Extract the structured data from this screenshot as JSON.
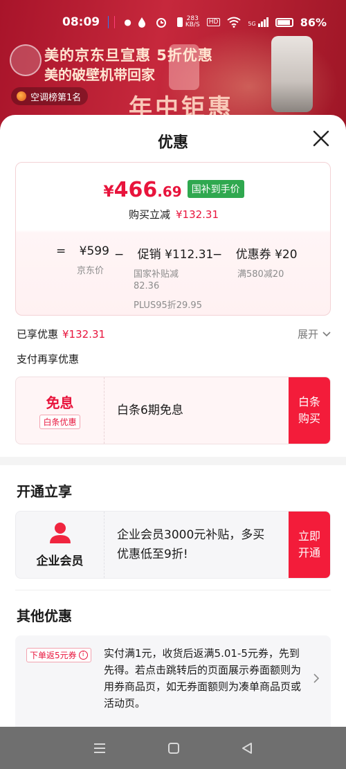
{
  "status_bar": {
    "time": "08:09",
    "net_speed_top": "283",
    "net_speed_unit": "KB/S",
    "hd": "HD",
    "signal_label": "5G",
    "battery": "86%"
  },
  "background": {
    "promo_line1": "美的京东旦宣惠 5折优惠",
    "promo_line2": "美的破壁机带回家",
    "rank_pill": "空调榜第1名",
    "banner_text": "年中钜惠"
  },
  "sheet": {
    "title": "优惠",
    "price_card": {
      "yen": "¥",
      "price_int": "466",
      "price_dec": ".69",
      "tag": "国补到手价",
      "reduce_label": "购买立减",
      "reduce_amount": "¥132.31",
      "formula": {
        "eq": "=",
        "base_value": "¥599",
        "base_label": "京东价",
        "minus1": "−",
        "promo_label": "促销",
        "promo_value": "¥112.31",
        "promo_sub1": "国家补贴减",
        "promo_sub1_value": "82.36",
        "promo_sub2": "PLUS95折29.95",
        "minus2": "−",
        "coupon_label": "优惠券",
        "coupon_value": "¥20",
        "coupon_sub": "满580减20"
      }
    },
    "enjoyed_label": "已享优惠",
    "enjoyed_amount": "¥132.31",
    "expand_label": "展开",
    "pay_more_label": "支付再享优惠",
    "baitiao_offer": {
      "title": "免息",
      "tag": "白条优惠",
      "desc": "白条6期免息",
      "button_line1": "白条",
      "button_line2": "购买"
    },
    "open_section_title": "开通立享",
    "enterprise_offer": {
      "label": "企业会员",
      "desc_line1": "企业会员3000元补贴，多买",
      "desc_line2": "优惠低至9折!",
      "button_line1": "立即",
      "button_line2": "开通"
    },
    "other_section_title": "其他优惠",
    "other_offer": {
      "tag": "下单返5元券",
      "info_icon_glyph": "i",
      "desc": "实付满1元，收货后返满5.01-5元券，先到先得。若点击跳转后的页面展示券面额则为用券商品页，如无券面额则为凑单商品页或活动页。"
    }
  },
  "colors": {
    "accent_red": "#e8143c",
    "button_red": "#f31c3a",
    "tag_green": "#2fa84f"
  }
}
